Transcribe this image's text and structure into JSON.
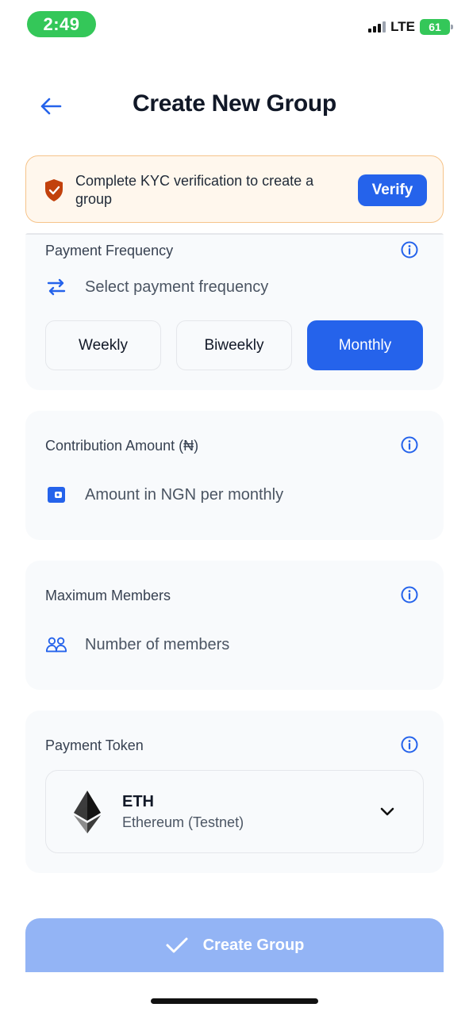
{
  "status_bar": {
    "time": "2:49",
    "network": "LTE",
    "battery": "61"
  },
  "header": {
    "title": "Create New Group"
  },
  "kyc_banner": {
    "message": "Complete KYC verification to create a group",
    "verify_label": "Verify"
  },
  "payment_frequency": {
    "label": "Payment Frequency",
    "placeholder": "Select payment frequency",
    "options": [
      "Weekly",
      "Biweekly",
      "Monthly"
    ],
    "selected": "Monthly"
  },
  "contribution": {
    "label": "Contribution Amount (₦)",
    "placeholder": "Amount in NGN per monthly"
  },
  "members": {
    "label": "Maximum Members",
    "placeholder": "Number of members"
  },
  "token": {
    "label": "Payment Token",
    "symbol": "ETH",
    "name": "Ethereum (Testnet)"
  },
  "create_button": {
    "label": "Create Group"
  },
  "colors": {
    "primary": "#2563eb",
    "success": "#34c759",
    "warning_border": "#f6c48a",
    "shield": "#c2410c",
    "disabled_button": "#93b4f5"
  },
  "icons": [
    "back-arrow-icon",
    "shield-icon",
    "info-icon",
    "repeat-icon",
    "wallet-icon",
    "users-icon",
    "ethereum-icon",
    "chevron-down-icon",
    "check-icon"
  ]
}
